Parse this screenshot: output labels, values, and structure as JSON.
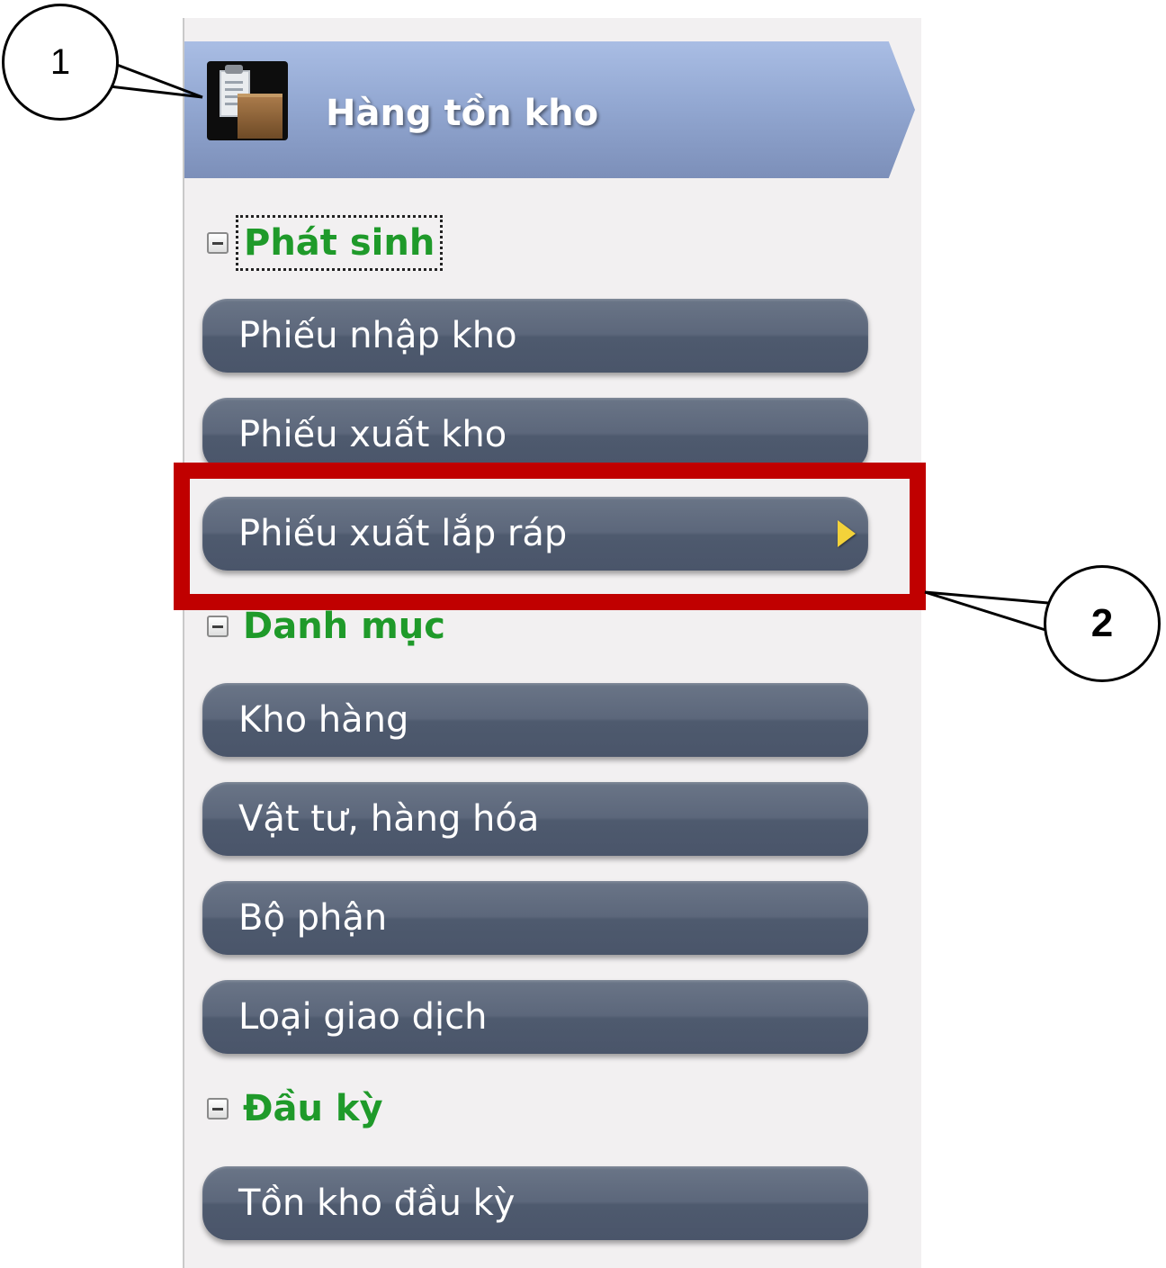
{
  "header": {
    "title": "Hàng tồn kho",
    "icon": "inventory-icon"
  },
  "sections": [
    {
      "label": "Phát sinh",
      "items": [
        "Phiếu nhập kho",
        "Phiếu xuất kho",
        "Phiếu xuất lắp ráp"
      ]
    },
    {
      "label": "Danh mục",
      "items": [
        "Kho hàng",
        "Vật tư, hàng hóa",
        "Bộ phận",
        "Loại giao dịch"
      ]
    },
    {
      "label": "Đầu kỳ",
      "items": [
        "Tồn kho đầu kỳ"
      ]
    }
  ],
  "callouts": [
    "1",
    "2"
  ],
  "colors": {
    "section_label": "#1f9a2a",
    "highlight": "#c00000",
    "button": "#56627a",
    "arrow": "#f3d23a"
  }
}
